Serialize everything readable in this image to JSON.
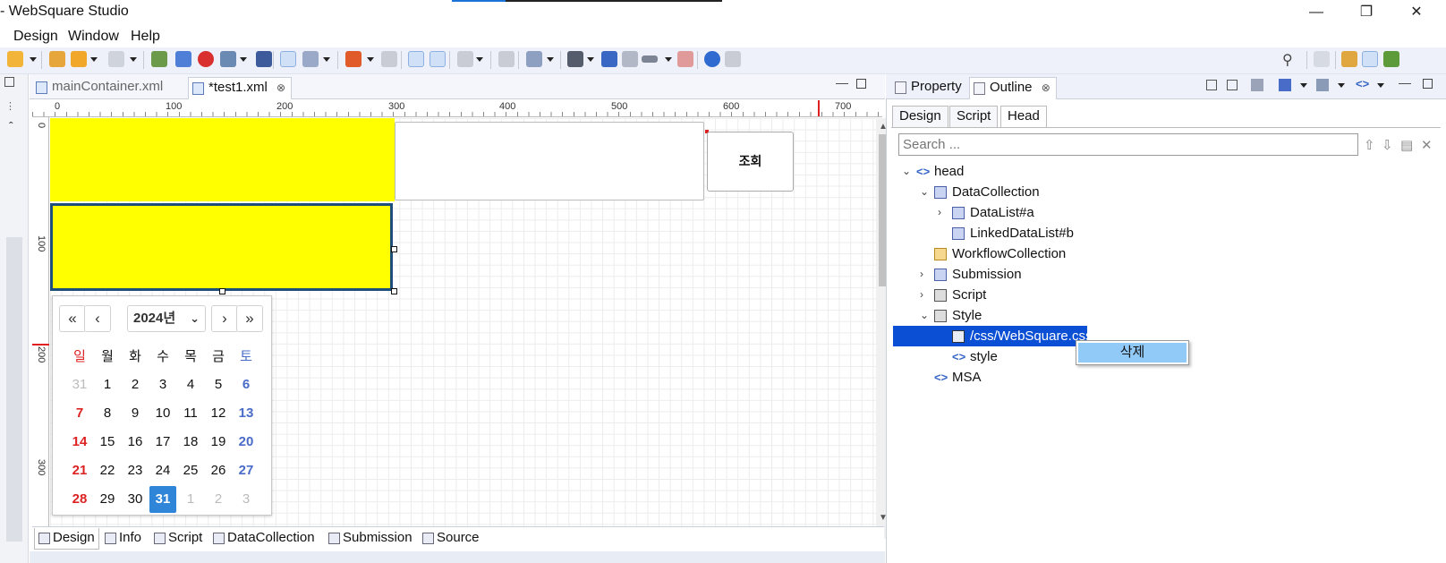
{
  "window": {
    "title": "- WebSquare Studio",
    "minimize_icon": "minimize-icon",
    "restore_icon": "restore-icon",
    "close_icon": "close-icon"
  },
  "menu": [
    "Design",
    "Window",
    "Help"
  ],
  "editor": {
    "tabs": [
      {
        "label": "mainContainer.xml",
        "active": false
      },
      {
        "label": "*test1.xml",
        "active": true
      }
    ],
    "ruler_top": [
      "0",
      "100",
      "200",
      "300",
      "400",
      "500",
      "600",
      "700"
    ],
    "ruler_left": [
      "0",
      "100",
      "200",
      "300"
    ],
    "canvas": {
      "search_button_label": "조회",
      "box_color": "#ffff00"
    },
    "calendar": {
      "year_label": "2024년",
      "prev_year": "«",
      "prev_month": "‹",
      "next_month": "›",
      "next_year": "»",
      "weekdays": [
        "일",
        "월",
        "화",
        "수",
        "목",
        "금",
        "토"
      ],
      "weeks": [
        [
          "31",
          "1",
          "2",
          "3",
          "4",
          "5",
          "6"
        ],
        [
          "7",
          "8",
          "9",
          "10",
          "11",
          "12",
          "13"
        ],
        [
          "14",
          "15",
          "16",
          "17",
          "18",
          "19",
          "20"
        ],
        [
          "21",
          "22",
          "23",
          "24",
          "25",
          "26",
          "27"
        ],
        [
          "28",
          "29",
          "30",
          "31",
          "1",
          "2",
          "3"
        ]
      ],
      "selected": "31"
    },
    "bottom_tabs": [
      "Design",
      "Info",
      "Script",
      "DataCollection",
      "Submission",
      "Source"
    ]
  },
  "right_panel": {
    "tabs": [
      {
        "label": "Property",
        "active": false
      },
      {
        "label": "Outline",
        "active": true
      }
    ],
    "sub_tabs": [
      "Design",
      "Script",
      "Head"
    ],
    "active_sub_tab": "Head",
    "search_placeholder": "Search ...",
    "tree": [
      {
        "label": "head",
        "level": 0,
        "twisty": "⌄",
        "kind": "tag"
      },
      {
        "label": "DataCollection",
        "level": 1,
        "twisty": "⌄",
        "kind": "icon"
      },
      {
        "label": "DataList#a",
        "level": 2,
        "twisty": "›",
        "kind": "icon"
      },
      {
        "label": "LinkedDataList#b",
        "level": 2,
        "twisty": "",
        "kind": "icon"
      },
      {
        "label": "WorkflowCollection",
        "level": 1,
        "twisty": "",
        "kind": "icon"
      },
      {
        "label": "Submission",
        "level": 1,
        "twisty": "›",
        "kind": "icon"
      },
      {
        "label": "Script",
        "level": 1,
        "twisty": "›",
        "kind": "icon"
      },
      {
        "label": "Style",
        "level": 1,
        "twisty": "⌄",
        "kind": "icon"
      },
      {
        "label": "/css/WebSquare.css",
        "level": 2,
        "twisty": "",
        "kind": "icon",
        "selected": true
      },
      {
        "label": "style",
        "level": 2,
        "twisty": "",
        "kind": "tag"
      },
      {
        "label": "MSA",
        "level": 1,
        "twisty": "",
        "kind": "tag"
      }
    ],
    "context_menu": [
      "삭제"
    ]
  },
  "colors": {
    "selection": "#0a4fd4",
    "context_highlight": "#91c9f7",
    "calendar_selected": "#2f86d8",
    "sunday": "#dd2222",
    "saturday": "#4a6cc9"
  }
}
